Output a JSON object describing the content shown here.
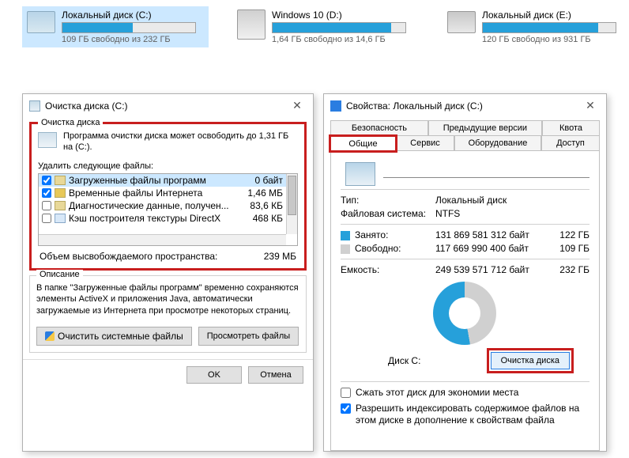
{
  "drives": [
    {
      "name": "Локальный диск (C:)",
      "free": "109 ГБ свободно из 232 ГБ",
      "fill_pct": 53,
      "selected": true,
      "kind": "hdd"
    },
    {
      "name": "Windows 10 (D:)",
      "free": "1,64 ГБ свободно из 14,6 ГБ",
      "fill_pct": 89,
      "selected": false,
      "kind": "sys"
    },
    {
      "name": "Локальный диск (E:)",
      "free": "120 ГБ свободно из 931 ГБ",
      "fill_pct": 87,
      "selected": false,
      "kind": "ssd"
    }
  ],
  "cleanup": {
    "title": "Очистка диска  (C:)",
    "group_label": "Очистка диска",
    "intro": "Программа очистки диска может освободить до 1,31 ГБ на  (C:).",
    "delete_label": "Удалить следующие файлы:",
    "files": [
      {
        "checked": true,
        "name": "Загруженные файлы программ",
        "size": "0 байт",
        "selected": true
      },
      {
        "checked": true,
        "name": "Временные файлы Интернета",
        "size": "1,46 МБ",
        "selected": false,
        "icon": "lock"
      },
      {
        "checked": false,
        "name": "Диагностические данные, получен...",
        "size": "83,6 КБ",
        "selected": false
      },
      {
        "checked": false,
        "name": "Кэш построителя текстуры DirectX",
        "size": "468 КБ",
        "selected": false,
        "icon": "doc"
      }
    ],
    "total_label": "Объем высвобождаемого пространства:",
    "total_value": "239 МБ",
    "desc_label": "Описание",
    "desc_text": "В папке \"Загруженные файлы программ\" временно сохраняются элементы ActiveX и приложения Java, автоматически загружаемые из Интернета при просмотре некоторых страниц.",
    "btn_system": "Очистить системные файлы",
    "btn_view": "Просмотреть файлы",
    "btn_ok": "OK",
    "btn_cancel": "Отмена"
  },
  "props": {
    "title": "Свойства: Локальный диск (C:)",
    "tabs_row1": [
      "Безопасность",
      "Предыдущие версии",
      "Квота"
    ],
    "tabs_row2": [
      "Общие",
      "Сервис",
      "Оборудование",
      "Доступ"
    ],
    "type_label": "Тип:",
    "type_value": "Локальный диск",
    "fs_label": "Файловая система:",
    "fs_value": "NTFS",
    "used_label": "Занято:",
    "used_bytes": "131 869 581 312 байт",
    "used_h": "122 ГБ",
    "free_label": "Свободно:",
    "free_bytes": "117 669 990 400 байт",
    "free_h": "109 ГБ",
    "cap_label": "Емкость:",
    "cap_bytes": "249 539 571 712 байт",
    "cap_h": "232 ГБ",
    "disk_label": "Диск C:",
    "cleanup_btn": "Очистка диска",
    "compress": "Сжать этот диск для экономии места",
    "index": "Разрешить индексировать содержимое файлов на этом диске в дополнение к свойствам файла"
  }
}
